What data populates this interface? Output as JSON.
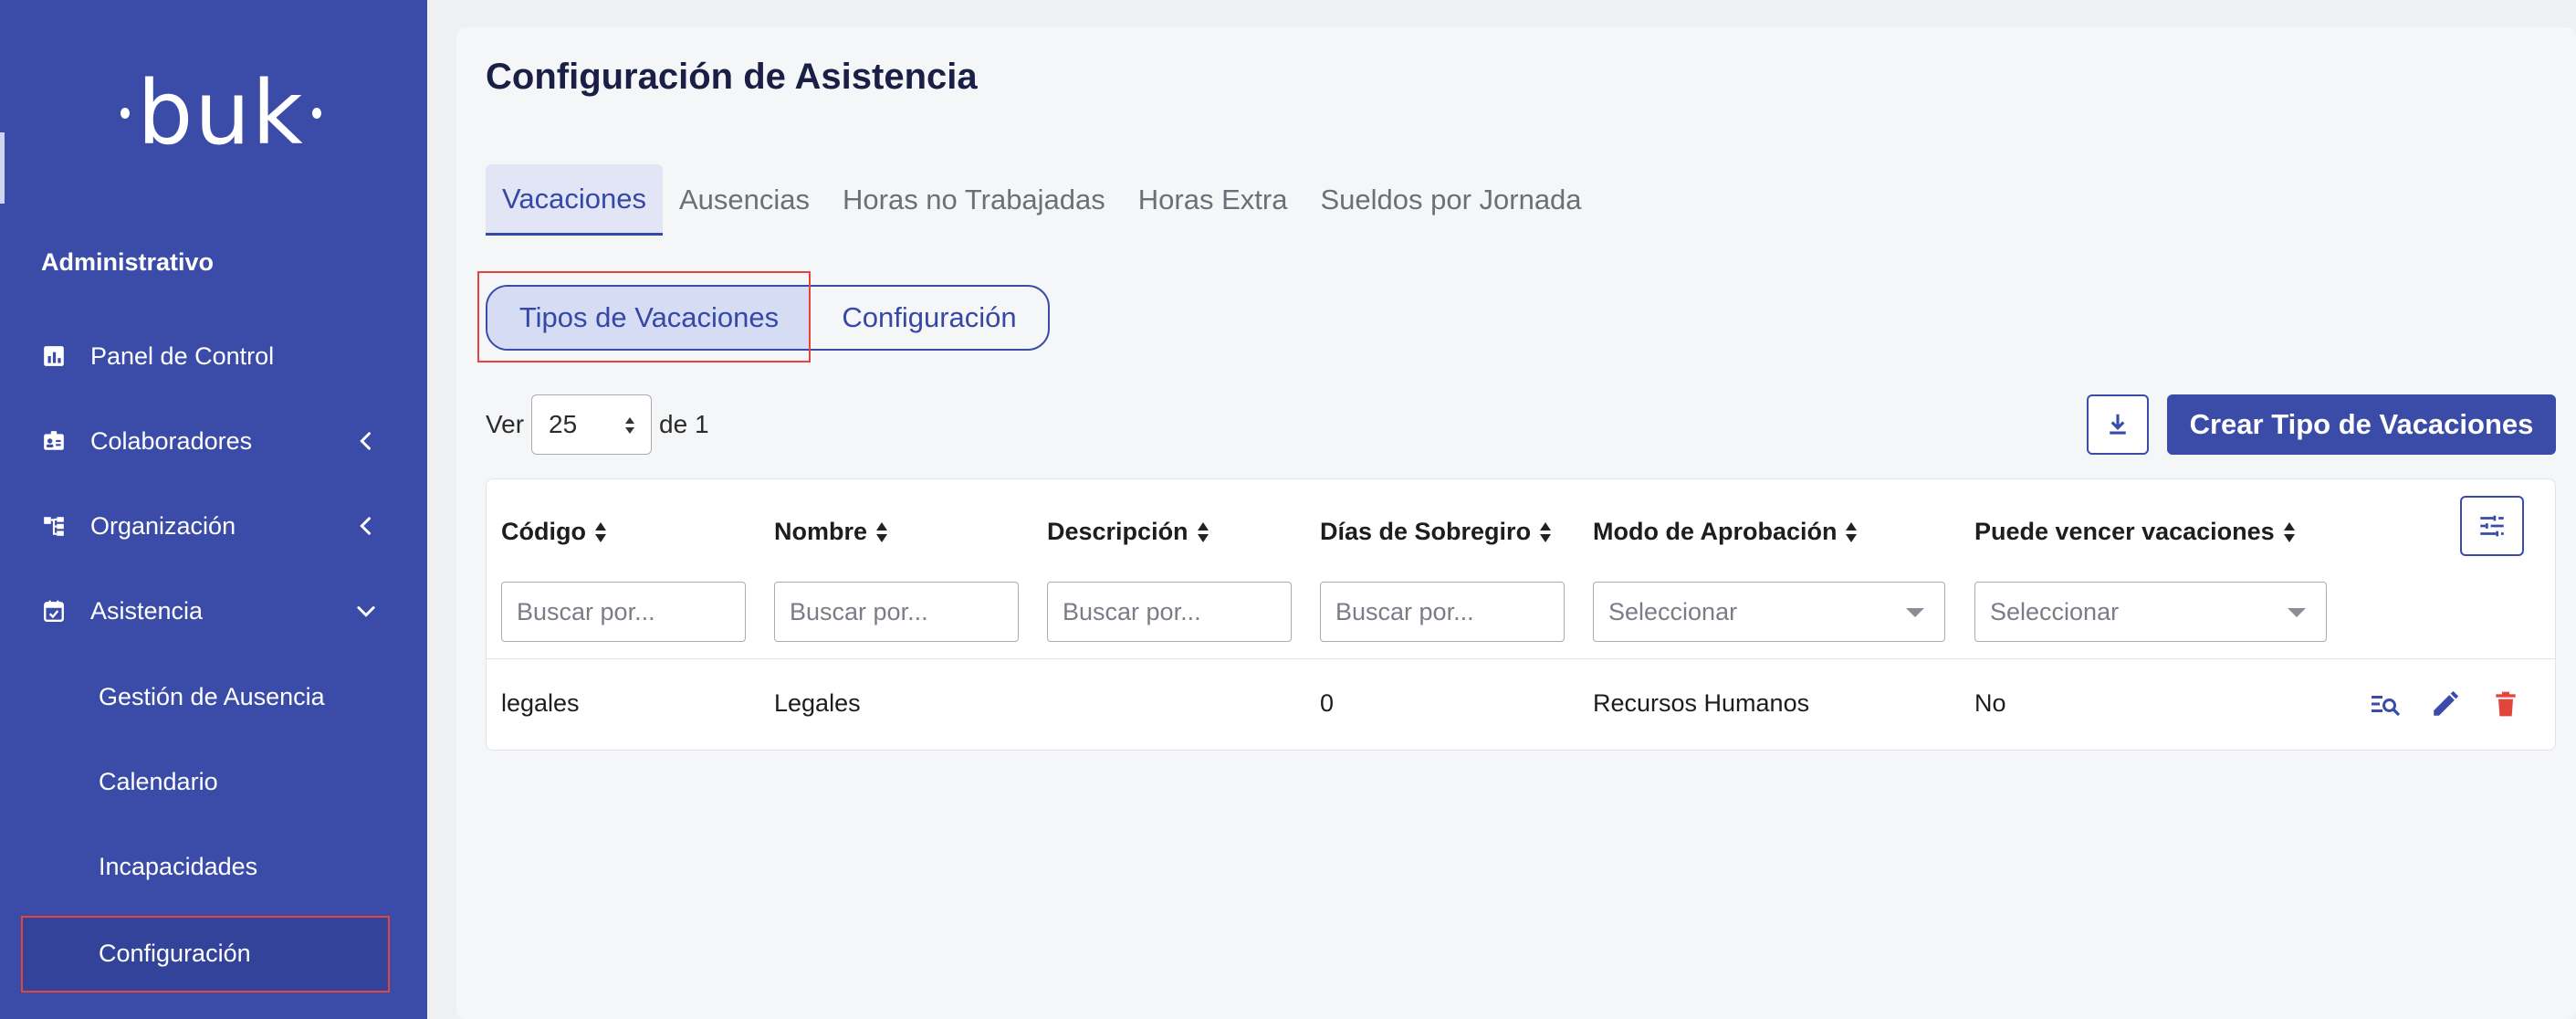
{
  "sidebar": {
    "logo": "buk",
    "section_title": "Administrativo",
    "items": [
      {
        "label": "Panel de Control",
        "icon": "chart-icon"
      },
      {
        "label": "Colaboradores",
        "icon": "id-card-icon"
      },
      {
        "label": "Organización",
        "icon": "org-chart-icon"
      },
      {
        "label": "Asistencia",
        "icon": "calendar-check-icon"
      }
    ],
    "subitems": [
      {
        "label": "Gestión de Ausencia"
      },
      {
        "label": "Calendario"
      },
      {
        "label": "Incapacidades"
      },
      {
        "label": "Configuración"
      }
    ]
  },
  "page": {
    "title": "Configuración de Asistencia"
  },
  "tabs": [
    {
      "label": "Vacaciones"
    },
    {
      "label": "Ausencias"
    },
    {
      "label": "Horas no Trabajadas"
    },
    {
      "label": "Horas Extra"
    },
    {
      "label": "Sueldos por Jornada"
    }
  ],
  "segmented": {
    "active": "Tipos de Vacaciones",
    "other": "Configuración"
  },
  "pagination": {
    "ver_label": "Ver",
    "per_page": "25",
    "of_label": "de 1"
  },
  "toolbar": {
    "create_label": "Crear Tipo de Vacaciones"
  },
  "table": {
    "headers": [
      "Código",
      "Nombre",
      "Descripción",
      "Días de Sobregiro",
      "Modo de Aprobación",
      "Puede vencer vacaciones"
    ],
    "filters": [
      "Buscar por...",
      "Buscar por...",
      "Buscar por...",
      "Buscar por...",
      "Seleccionar",
      "Seleccionar"
    ],
    "rows": [
      [
        "legales",
        "Legales",
        "",
        "0",
        "Recursos Humanos",
        "No"
      ]
    ]
  },
  "colors": {
    "sidebar": "#3a4ca8",
    "accent": "#3548a6",
    "highlight": "#e2453c",
    "delete": "#e2453c"
  }
}
